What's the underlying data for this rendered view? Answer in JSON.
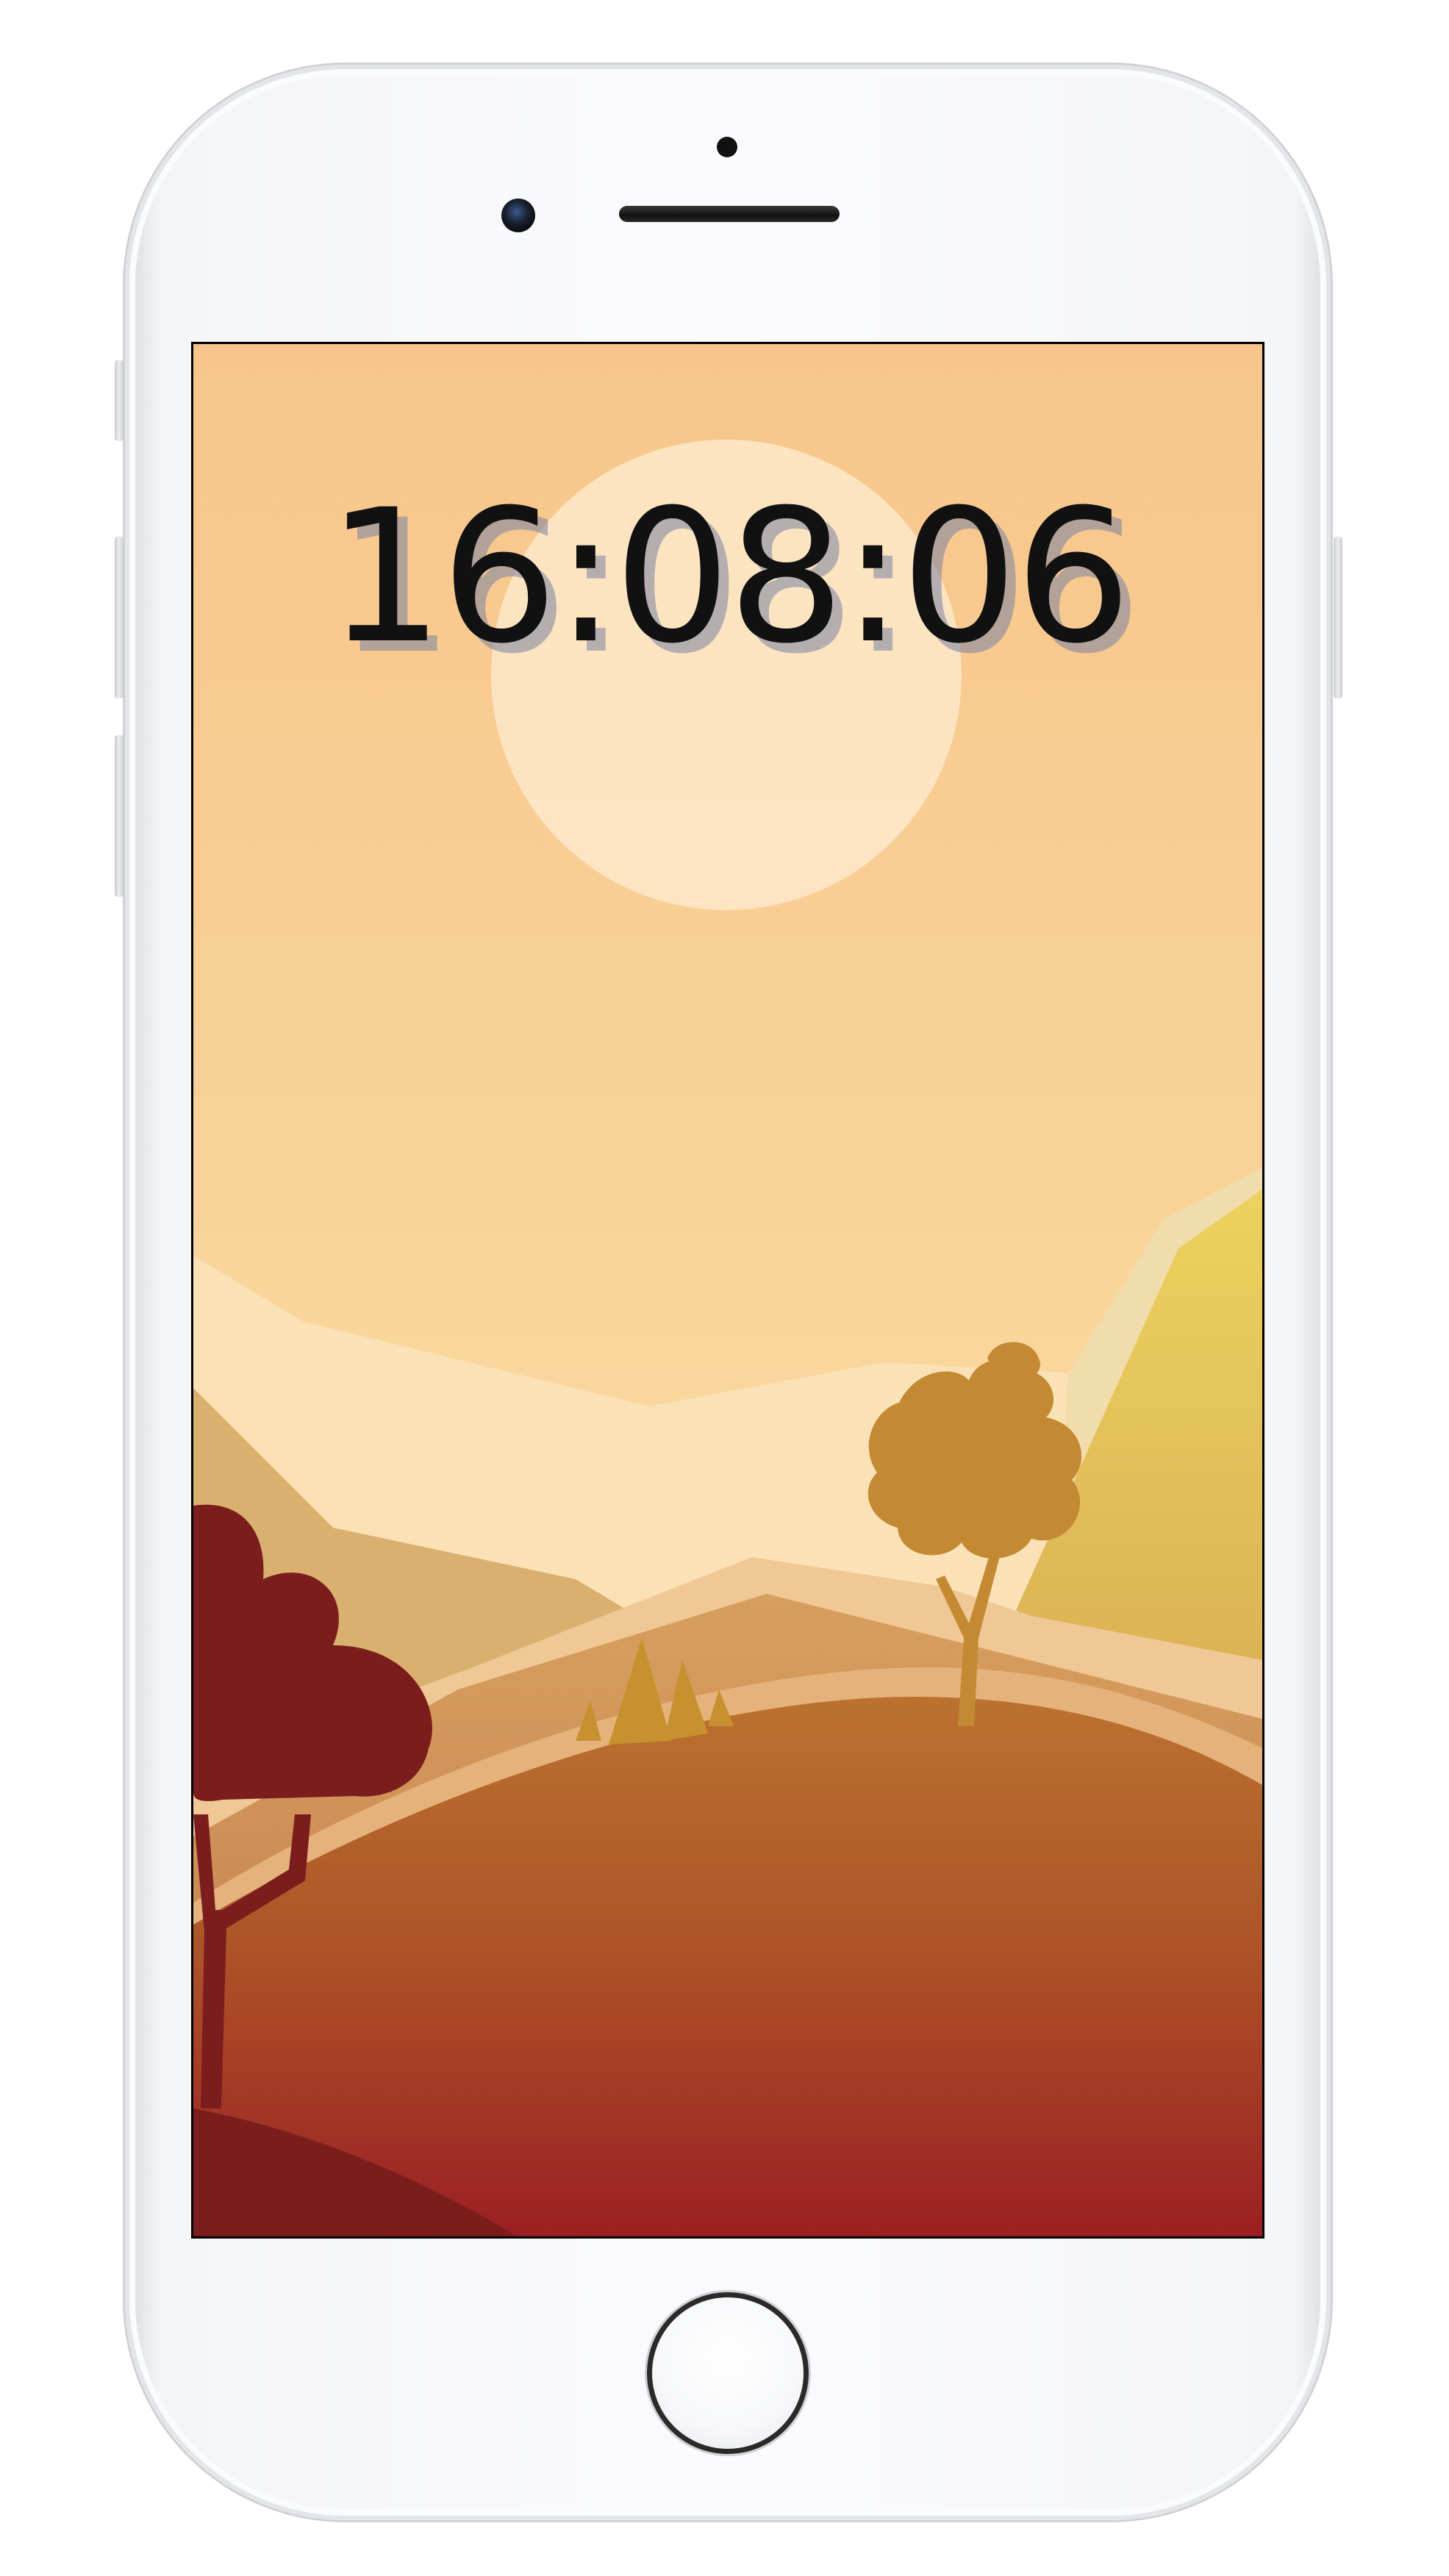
{
  "device": {
    "model": "smartphone",
    "color": "silver-white"
  },
  "lockscreen": {
    "time": "16:08:06",
    "wallpaper": "sunset-hills-landscape"
  },
  "palette": {
    "sky_top": "#f7c58a",
    "sky_bottom": "#fbe3a8",
    "sun": "#fde6c6",
    "tree_dark": "#7b1d1d",
    "tree_gold": "#c48a33",
    "hill_bottom": "#9b1f22"
  }
}
